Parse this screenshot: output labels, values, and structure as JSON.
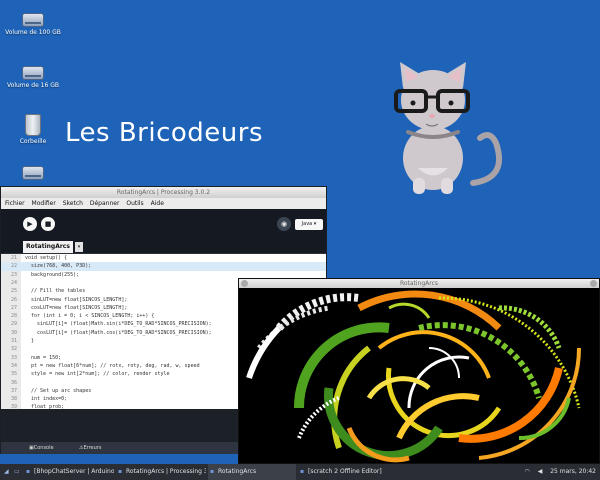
{
  "desktop": {
    "icons": [
      {
        "label": "Volume de 100 GB",
        "icon": "drive-icon"
      },
      {
        "label": "Volume de 16 GB",
        "icon": "drive-icon"
      },
      {
        "label": "Corbeille",
        "icon": "trash-icon"
      },
      {
        "label": "",
        "icon": "drive-icon"
      }
    ],
    "wallpaper_text": "Les Bricodeurs",
    "colors": {
      "background": "#1e63b8",
      "accent": "#6f95d8"
    }
  },
  "ide": {
    "title": "RotatingArcs | Processing 3.0.2",
    "menu": [
      "Fichier",
      "Modifier",
      "Sketch",
      "Dépanner",
      "Outils",
      "Aide"
    ],
    "mode": "Java ▾",
    "tab": "RotatingArcs",
    "tab_menu": "▾",
    "run_icon": "▶",
    "stop_icon": "■",
    "debug_icon": "◉",
    "code": [
      {
        "num": "21",
        "text": "void setup() {"
      },
      {
        "num": "22",
        "text": "  size(768, 400, P3D);"
      },
      {
        "num": "23",
        "text": "  background(255);"
      },
      {
        "num": "24",
        "text": ""
      },
      {
        "num": "25",
        "text": "  // Fill the tables"
      },
      {
        "num": "26",
        "text": "  sinLUT=new float[SINCOS_LENGTH];"
      },
      {
        "num": "27",
        "text": "  cosLUT=new float[SINCOS_LENGTH];"
      },
      {
        "num": "28",
        "text": "  for (int i = 0; i < SINCOS_LENGTH; i++) {"
      },
      {
        "num": "29",
        "text": "    sinLUT[i]= (float)Math.sin(i*DEG_TO_RAD*SINCOS_PRECISION);"
      },
      {
        "num": "30",
        "text": "    cosLUT[i]= (float)Math.cos(i*DEG_TO_RAD*SINCOS_PRECISION);"
      },
      {
        "num": "31",
        "text": "  }"
      },
      {
        "num": "32",
        "text": ""
      },
      {
        "num": "33",
        "text": "  num = 150;"
      },
      {
        "num": "34",
        "text": "  pt = new float[6*num]; // rotx, roty, deg, rad, w, speed"
      },
      {
        "num": "35",
        "text": "  style = new int[2*num]; // color, render style"
      },
      {
        "num": "36",
        "text": ""
      },
      {
        "num": "37",
        "text": "  // Set up arc shapes"
      },
      {
        "num": "38",
        "text": "  int index=0;"
      },
      {
        "num": "39",
        "text": "  float prob;"
      },
      {
        "num": "40",
        "text": "  for (int i=0; i<num; i++) {"
      },
      {
        "num": "41",
        "text": "    pt[index++] = random(PI*2); // Random X axis rotation"
      }
    ],
    "console_tabs": [
      "Console",
      "Erreurs"
    ]
  },
  "sketch": {
    "title": "RotatingArcs"
  },
  "taskbar": {
    "items": [
      "[BhopChatServer | Arduino...",
      "RotatingArcs | Processing 3...",
      "RotatingArcs",
      "[scratch 2 Offline Editor]"
    ],
    "tray": {
      "wifi": "wifi-icon",
      "clock": "25 mars, 20:42"
    }
  }
}
